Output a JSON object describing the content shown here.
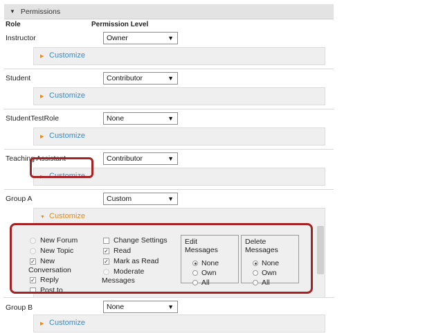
{
  "section": {
    "title": "Permissions",
    "role_header": "Role",
    "permission_header": "Permission Level"
  },
  "rows": [
    {
      "role": "Instructor",
      "level": "Owner",
      "customize": "Customize"
    },
    {
      "role": "Student",
      "level": "Contributor",
      "customize": "Customize"
    },
    {
      "role": "StudentTestRole",
      "level": "None",
      "customize": "Customize"
    },
    {
      "role": "Teaching Assistant",
      "level": "Contributor",
      "customize": "Customize"
    },
    {
      "role": "Group A",
      "level": "Custom",
      "customize": "Customize"
    },
    {
      "role": "Group B",
      "level": "None",
      "customize": "Customize"
    }
  ],
  "custom_permissions": {
    "new_forum": "New Forum",
    "new_topic": "New Topic",
    "new_conversation_1": "New",
    "new_conversation_2": "Conversation",
    "reply": "Reply",
    "post_to": "Post to",
    "change_settings": "Change Settings",
    "read": "Read",
    "mark_as_read": "Mark as Read",
    "moderate_1": "Moderate",
    "moderate_2": "Messages",
    "edit_title_1": "Edit",
    "edit_title_2": "Messages",
    "delete_title_1": "Delete",
    "delete_title_2": "Messages",
    "opt_none": "None",
    "opt_own": "Own",
    "opt_all": "All",
    "check": "✓"
  },
  "icons": {
    "section_toggle": "triangle-down-icon",
    "customize": "caret-right-icon",
    "select": "dropdown-arrow-icon"
  },
  "colors": {
    "link_blue": "#3a8bc7",
    "link_orange": "#e38b1f",
    "highlight_red": "#a42124"
  }
}
